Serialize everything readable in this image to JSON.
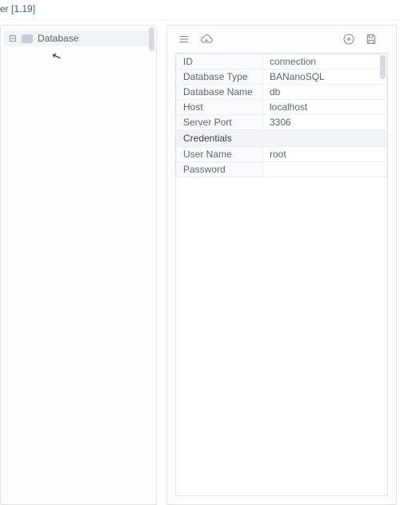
{
  "title_suffix": "er [1.19]",
  "tree": {
    "root_label": "Database"
  },
  "toolbar": {
    "menu_label": "menu",
    "cloud_label": "cloud-download",
    "add_label": "add",
    "save_label": "save"
  },
  "props": {
    "fields": [
      {
        "key": "ID",
        "value": "connection"
      },
      {
        "key": "Database Type",
        "value": "BANanoSQL"
      },
      {
        "key": "Database Name",
        "value": "db"
      },
      {
        "key": "Host",
        "value": "localhost"
      },
      {
        "key": "Server Port",
        "value": "3306"
      }
    ],
    "section": "Credentials",
    "credentials": [
      {
        "key": "User Name",
        "value": "root"
      },
      {
        "key": "Password",
        "value": ""
      }
    ]
  }
}
